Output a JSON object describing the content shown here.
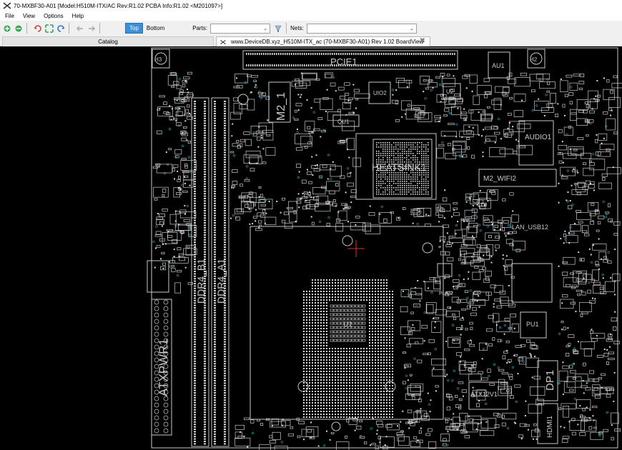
{
  "window": {
    "title": "70-MXBF30-A01 [Model:H510M-ITX/AC Rev:R1.02 PCBA Info:R1.02   <M201097>]"
  },
  "menu": {
    "items": [
      "File",
      "View",
      "Options",
      "Help"
    ]
  },
  "toolbar": {
    "top_label": "Top",
    "bottom_label": "Bottom",
    "parts_label": "Parts:",
    "parts_value": "",
    "nets_label": "Nets:",
    "nets_value": ""
  },
  "tabs": {
    "catalog": "Catalog",
    "board": "www.DeviceDB.xyz_H510M-ITX_ac (70-MXBF30-A01) Rev 1.02 BoardView"
  },
  "board": {
    "labels": {
      "pcie": "PCIE1",
      "au1": "AU1",
      "h2": "H2",
      "h3": "H3",
      "m2_1": "M2_1",
      "uio2": "UIO2",
      "u2": "U2",
      "qu1": "QU1",
      "audio1": "AUDIO1",
      "heatsink1": "HEATSINK1",
      "m2_wifi": "M2_WIFI2",
      "lan_usb12": "LAN_USB12",
      "ddr4_b1": "DDR4_B1",
      "ddr4_a1": "DDR4_A1",
      "atxpwr1": "ATXPWR1",
      "pu1": "PU1",
      "dp1": "DP1",
      "atx12v1": "ATX12V1",
      "hdmi1": "HDMI1",
      "pliq2": "PLIQ2",
      "cpu": "U1"
    },
    "colors": {
      "background": "#000000",
      "outline": "#c8c8c8",
      "pad": "#d8d8d8",
      "via": "#2a8aa0",
      "cursor": "#e03030"
    }
  }
}
